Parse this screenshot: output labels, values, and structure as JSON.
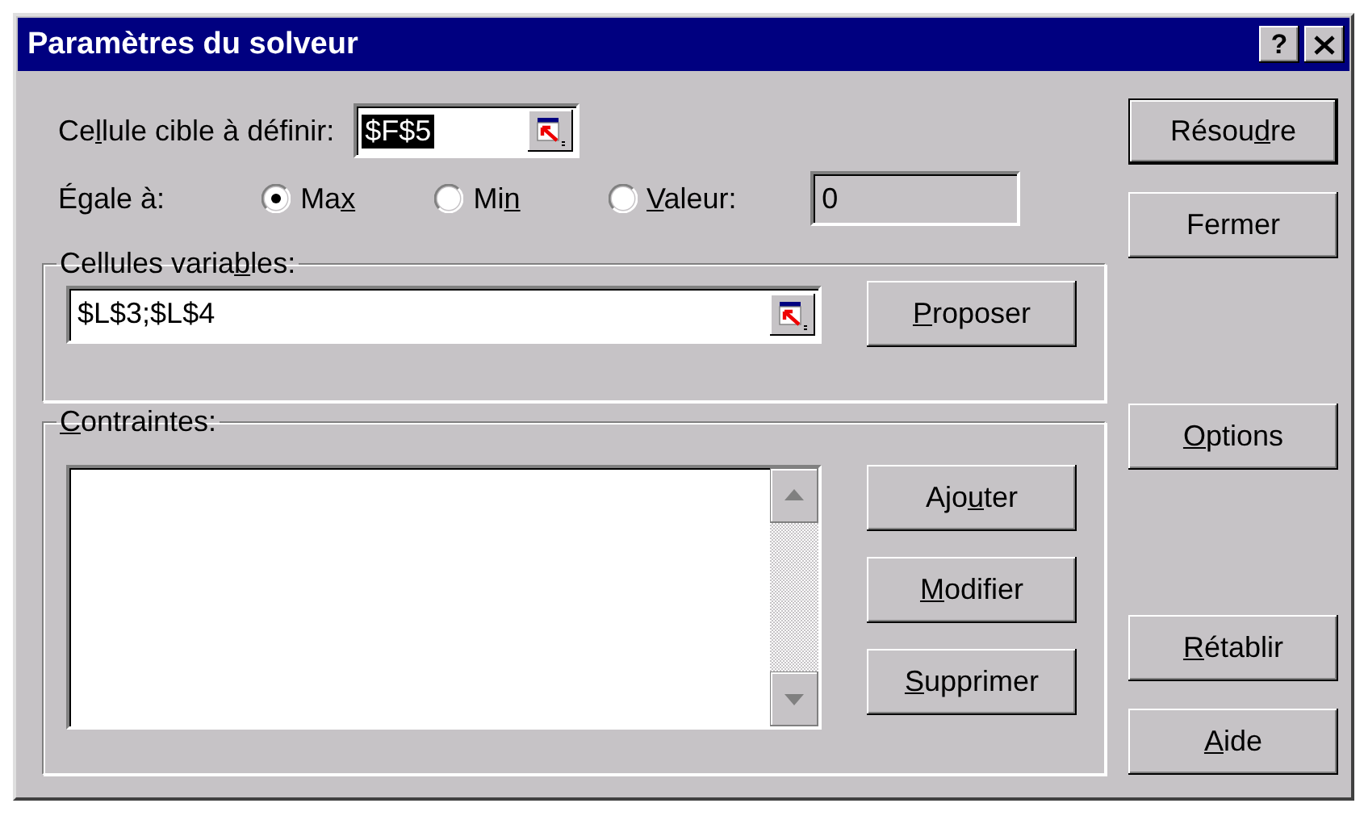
{
  "window": {
    "title": "Paramètres du solveur",
    "title_buttons": [
      {
        "kind": "help",
        "label": "?"
      },
      {
        "kind": "close"
      }
    ]
  },
  "target_cell": {
    "label": [
      {
        "text": "Ce",
        "key": false
      },
      {
        "text": "l",
        "key": true
      },
      {
        "text": "lule cible à définir:",
        "key": false
      }
    ],
    "value": "$F$5",
    "text_selected": true
  },
  "equal_to": {
    "label": [
      {
        "text": "Égale à:",
        "key": false
      }
    ],
    "options": [
      {
        "label": [
          {
            "text": "Ma",
            "key": false
          },
          {
            "text": "x",
            "key": true
          }
        ],
        "selected": true
      },
      {
        "label": [
          {
            "text": "Mi",
            "key": false
          },
          {
            "text": "n",
            "key": true
          }
        ],
        "selected": false
      },
      {
        "label": [
          {
            "text": "V",
            "key": true
          },
          {
            "text": "aleur:",
            "key": false
          }
        ],
        "selected": false
      }
    ],
    "value": "0"
  },
  "variable_cells": {
    "title": [
      {
        "text": "Cellules varia",
        "key": false
      },
      {
        "text": "b",
        "key": true
      },
      {
        "text": "les:",
        "key": false
      }
    ],
    "value": "$L$3;$L$4",
    "buttons": [
      {
        "label": [
          {
            "text": "P",
            "key": true
          },
          {
            "text": "roposer",
            "key": false
          }
        ]
      }
    ]
  },
  "constraints": {
    "title": [
      {
        "text": "C",
        "key": true
      },
      {
        "text": "ontraintes:",
        "key": false
      }
    ],
    "buttons": [
      {
        "label": [
          {
            "text": "Ajo",
            "key": false
          },
          {
            "text": "u",
            "key": true
          },
          {
            "text": "ter",
            "key": false
          }
        ]
      },
      {
        "label": [
          {
            "text": "M",
            "key": true
          },
          {
            "text": "odifier",
            "key": false
          }
        ]
      },
      {
        "label": [
          {
            "text": "S",
            "key": true
          },
          {
            "text": "upprimer",
            "key": false
          }
        ]
      }
    ]
  },
  "side_button_groups": [
    [
      {
        "label": [
          {
            "text": "Résou",
            "key": false
          },
          {
            "text": "d",
            "key": true
          },
          {
            "text": "re",
            "key": false
          }
        ],
        "default": true
      },
      {
        "label": [
          {
            "text": "Fermer",
            "key": false
          }
        ],
        "default": false
      }
    ],
    [
      {
        "label": [
          {
            "text": "O",
            "key": true
          },
          {
            "text": "ptions",
            "key": false
          }
        ],
        "default": false
      }
    ],
    [
      {
        "label": [
          {
            "text": "R",
            "key": true
          },
          {
            "text": "établir",
            "key": false
          }
        ],
        "default": false
      },
      {
        "label": [
          {
            "text": "A",
            "key": true
          },
          {
            "text": "ide",
            "key": false
          }
        ],
        "default": false
      }
    ]
  ]
}
